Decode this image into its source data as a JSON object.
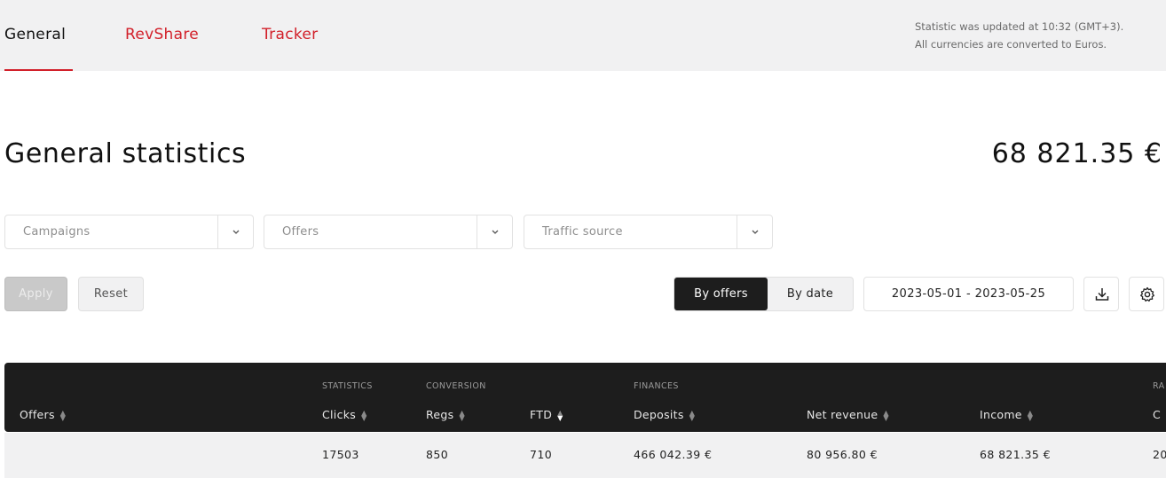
{
  "tabs": [
    {
      "label": "General"
    },
    {
      "label": "RevShare"
    },
    {
      "label": "Tracker"
    }
  ],
  "status_note": {
    "line1": "Statistic was updated at 10:32 (GMT+3).",
    "line2": "All currencies are converted to Euros."
  },
  "page": {
    "title": "General statistics",
    "total": "68 821.35 €"
  },
  "filters": [
    {
      "placeholder": "Campaigns",
      "icon": "chevron-down-icon"
    },
    {
      "placeholder": "Offers",
      "icon": "chevron-down-icon"
    },
    {
      "placeholder": "Traffic source",
      "icon": "chevron-down-icon"
    }
  ],
  "actions": {
    "apply": "Apply",
    "reset": "Reset"
  },
  "grouping": {
    "by_offers": "By offers",
    "by_date": "By date",
    "selected": "By offers"
  },
  "date_range": "2023-05-01 - 2023-05-25",
  "toolbar_icons": [
    "download-icon",
    "gear-icon"
  ],
  "table": {
    "groups": {
      "statistics": "STATISTICS",
      "conversion": "CONVERSION",
      "finances": "FINANCES",
      "partial": "RA"
    },
    "columns": [
      "Offers",
      "Clicks",
      "Regs",
      "FTD",
      "Deposits",
      "Net revenue",
      "Income",
      "C"
    ],
    "sorted_column": "FTD",
    "total_row": {
      "offers": "",
      "clicks": "17503",
      "regs": "850",
      "ftd": "710",
      "deposits": "466 042.39 €",
      "net_revenue": "80 956.80 €",
      "income": "68 821.35 €",
      "partial": "20"
    }
  },
  "colors": {
    "accent": "#d2202a",
    "header_dark": "#1d1d1d",
    "topbar_bg": "#f1f1f2"
  }
}
